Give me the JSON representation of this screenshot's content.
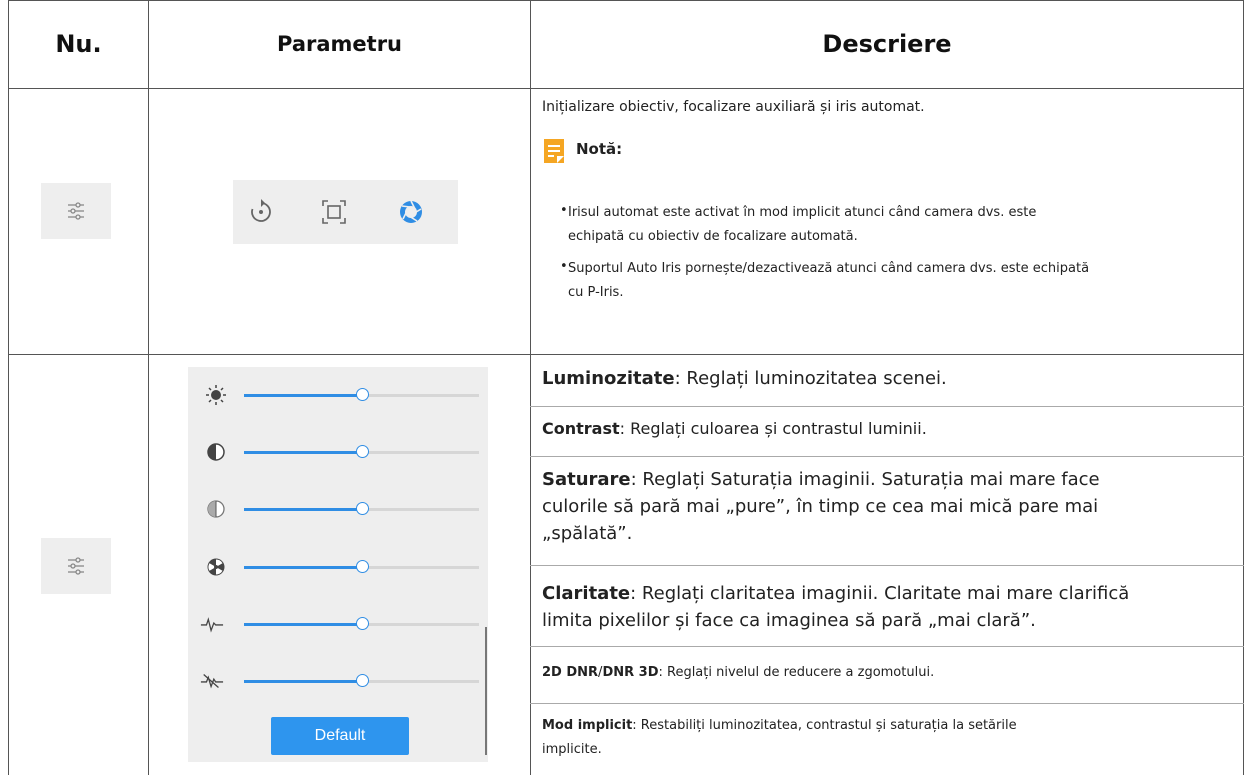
{
  "header": {
    "col1": "Nu.",
    "col2": "Parametru",
    "col3": "Descriere"
  },
  "row1": {
    "row_icon": "settings-sliders-icon",
    "toolbar_icons": [
      "refresh-icon",
      "focus-frame-icon",
      "iris-icon"
    ],
    "intro": "Inițializare obiectiv, focalizare auxiliară și iris automat.",
    "note_title": "Notă:",
    "bullets": [
      "Irisul automat este activat în mod implicit atunci când camera dvs. este",
      "echipată cu obiectiv de focalizare automată.",
      "Suportul Auto Iris pornește/dezactivează atunci când camera dvs. este echipată",
      "cu P-Iris."
    ]
  },
  "row2": {
    "row_icon": "settings-sliders-icon",
    "sliders": [
      {
        "icon": "brightness-icon",
        "value": 50
      },
      {
        "icon": "contrast-icon",
        "value": 50
      },
      {
        "icon": "saturation-icon",
        "value": 50
      },
      {
        "icon": "sharpness-icon",
        "value": 50
      },
      {
        "icon": "pulse-icon",
        "value": 50
      },
      {
        "icon": "noise-icon",
        "value": 50
      }
    ],
    "default_button": "Default",
    "desc": [
      {
        "bold": "Luminozitate",
        "text": ": Reglați luminozitatea scenei."
      },
      {
        "bold": "Contrast",
        "text": ": Reglați culoarea și contrastul luminii."
      },
      {
        "bold": "Saturare",
        "text": ": Reglați Saturația imaginii. Saturația mai mare face",
        "line2": "culorile să pară mai „pure”, în timp ce cea mai mică pare mai",
        "line3": "„spălată”."
      },
      {
        "bold": "Claritate",
        "text": ": Reglați claritatea imaginii. Claritate mai mare clarifică",
        "line2": "limita pixelilor și face ca imaginea să pară „mai clară”."
      },
      {
        "bold": "2D DNR",
        "sep": "/",
        "bold2": "DNR 3D",
        "text": ": Reglați nivelul de reducere a zgomotului."
      },
      {
        "bold": "Mod implicit",
        "text": ": Restabiliți luminozitatea, contrastul și saturația la setările",
        "line2": "implicite."
      }
    ]
  },
  "colors": {
    "accent": "#2f8de4",
    "note": "#f5a623",
    "button": "#2e95ee"
  }
}
